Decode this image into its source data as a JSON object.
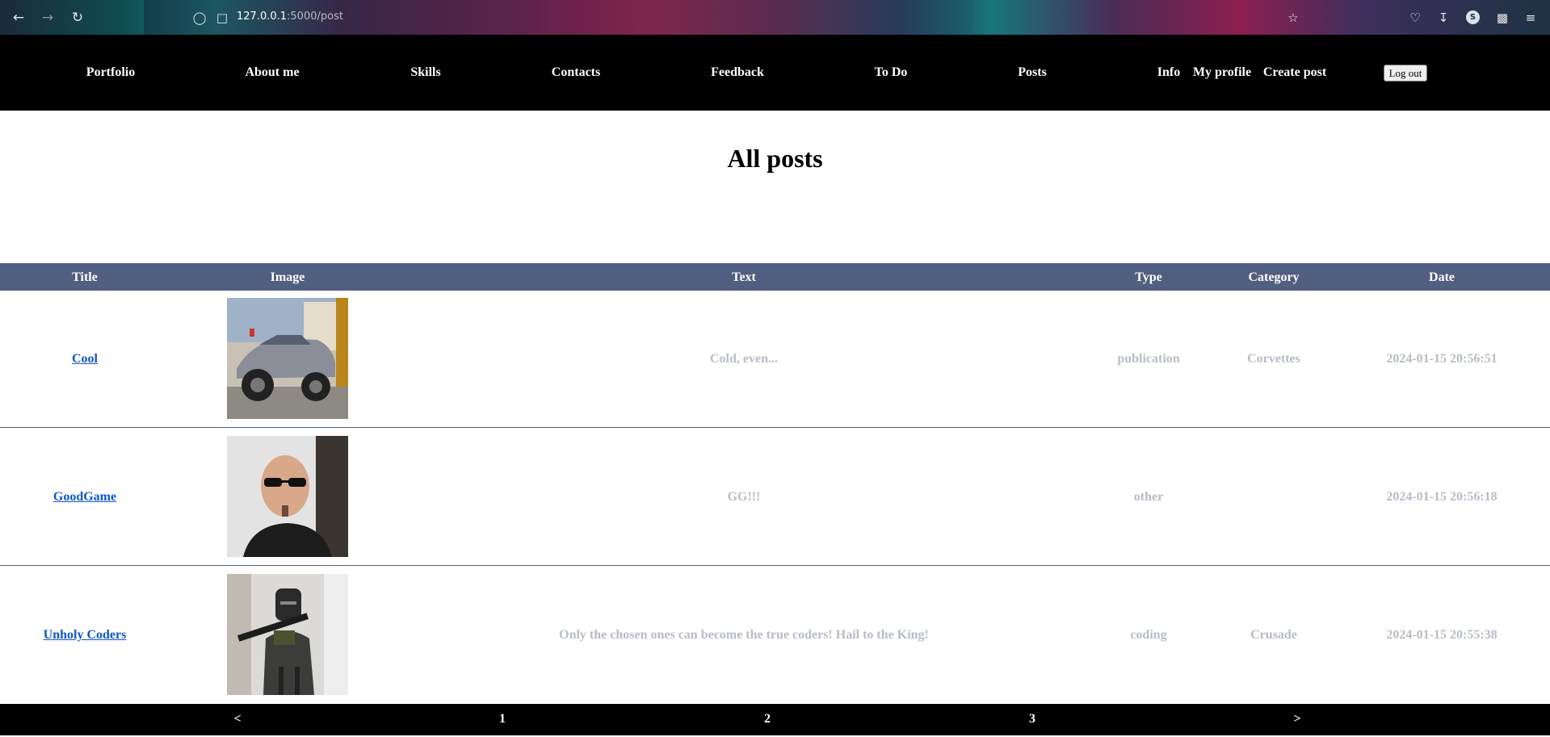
{
  "browser": {
    "url_host": "127.0.0.1",
    "url_path": ":5000/post",
    "profile_initial": "S"
  },
  "nav": {
    "links": [
      "Portfolio",
      "About me",
      "Skills",
      "Contacts",
      "Feedback",
      "To Do",
      "Posts",
      "Info",
      "My profile",
      "Create post"
    ],
    "logout_label": "Log out"
  },
  "page": {
    "title": "All posts"
  },
  "table": {
    "headers": [
      "Title",
      "Image",
      "Text",
      "Type",
      "Category",
      "Date"
    ],
    "rows": [
      {
        "title": "Cool",
        "image": "car-photo",
        "text": "Cold, even...",
        "type": "publication",
        "category": "Corvettes",
        "date": "2024-01-15 20:56:51"
      },
      {
        "title": "GoodGame",
        "image": "man-portrait-photo",
        "text": "GG!!!",
        "type": "other",
        "category": "",
        "date": "2024-01-15 20:56:18"
      },
      {
        "title": "Unholy Coders",
        "image": "knight-photo",
        "text": "Only the chosen ones can become the true coders! Hail to the King!",
        "type": "coding",
        "category": "Crusade",
        "date": "2024-01-15 20:55:38"
      }
    ]
  },
  "pagination": {
    "prev": "<",
    "pages": [
      "1",
      "2",
      "3"
    ],
    "next": ">"
  },
  "colors": {
    "header_bg": "#525e7f",
    "nav_bg": "#000000",
    "link": "#1155cc",
    "muted_text": "#b7bcc6"
  }
}
